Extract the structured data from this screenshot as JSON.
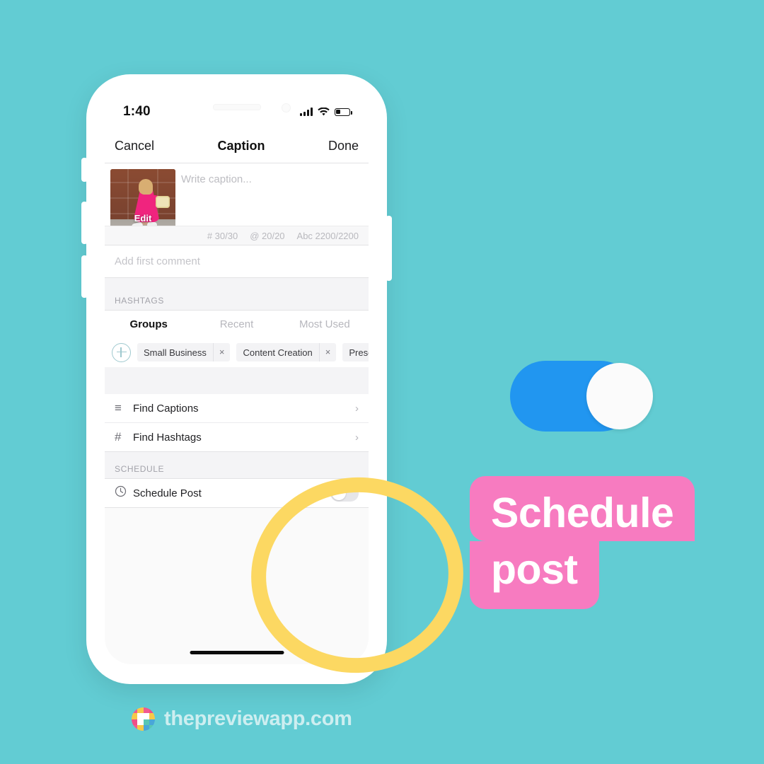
{
  "theme": {
    "background": "#62ccd3",
    "accent_pink": "#f77bc0",
    "accent_yellow": "#fcd862",
    "accent_blue": "#2196f0",
    "brand_text": "#cdeef0"
  },
  "phone": {
    "status_bar": {
      "time": "1:40",
      "signal_icon": "cellular-bars-icon",
      "wifi_icon": "wifi-icon",
      "battery_icon": "battery-low-icon"
    },
    "nav_bar": {
      "cancel_label": "Cancel",
      "title": "Caption",
      "done_label": "Done"
    },
    "caption": {
      "thumbnail_edit_label": "Edit",
      "placeholder": "Write caption...",
      "value": "",
      "counters": {
        "hashtags": "# 30/30",
        "mentions": "@ 20/20",
        "characters": "Abc 2200/2200"
      }
    },
    "first_comment": {
      "placeholder": "Add first comment",
      "value": ""
    },
    "hashtags": {
      "section_label": "HASHTAGS",
      "tabs": [
        {
          "label": "Groups",
          "active": true
        },
        {
          "label": "Recent",
          "active": false
        },
        {
          "label": "Most Used",
          "active": false
        }
      ],
      "add_icon": "plus-circle-icon",
      "chips": [
        {
          "label": "Small Business",
          "remove_icon": "close-icon",
          "remove_label": "×"
        },
        {
          "label": "Content Creation",
          "remove_icon": "close-icon",
          "remove_label": "×"
        },
        {
          "label": "Prese",
          "remove_icon": "close-icon",
          "remove_label": "×"
        }
      ]
    },
    "tools": [
      {
        "icon": "lines-icon",
        "glyph": "≡",
        "label": "Find Captions",
        "chevron": "›"
      },
      {
        "icon": "hash-icon",
        "glyph": "#",
        "label": "Find Hashtags",
        "chevron": "›"
      }
    ],
    "schedule": {
      "section_label": "SCHEDULE",
      "row_icon": "clock-icon",
      "row_label": "Schedule Post",
      "toggle_state": "off"
    },
    "home_indicator": "home-indicator"
  },
  "overlays": {
    "big_toggle": {
      "name": "toggle-on-illustration",
      "state": "on"
    },
    "highlight_ring": {
      "name": "highlight-circle",
      "target": "Schedule Post toggle"
    },
    "callout": {
      "line1": "Schedule",
      "line2": "post"
    }
  },
  "footer": {
    "logo_icon": "preview-app-logo-icon",
    "brand": "thepreviewapp.com",
    "logo_tiles": [
      "#f15a8f",
      "#f7c948",
      "#f15a8f",
      "#ef4f88",
      "#f7c948",
      "#ffffff",
      "#ffffff",
      "#f7c948",
      "#ef4f88",
      "#ffffff",
      "#58c6b5",
      "#4aa7d8",
      "#f15a8f",
      "#f7c948",
      "#4aa7d8",
      "#58c6b5"
    ]
  }
}
